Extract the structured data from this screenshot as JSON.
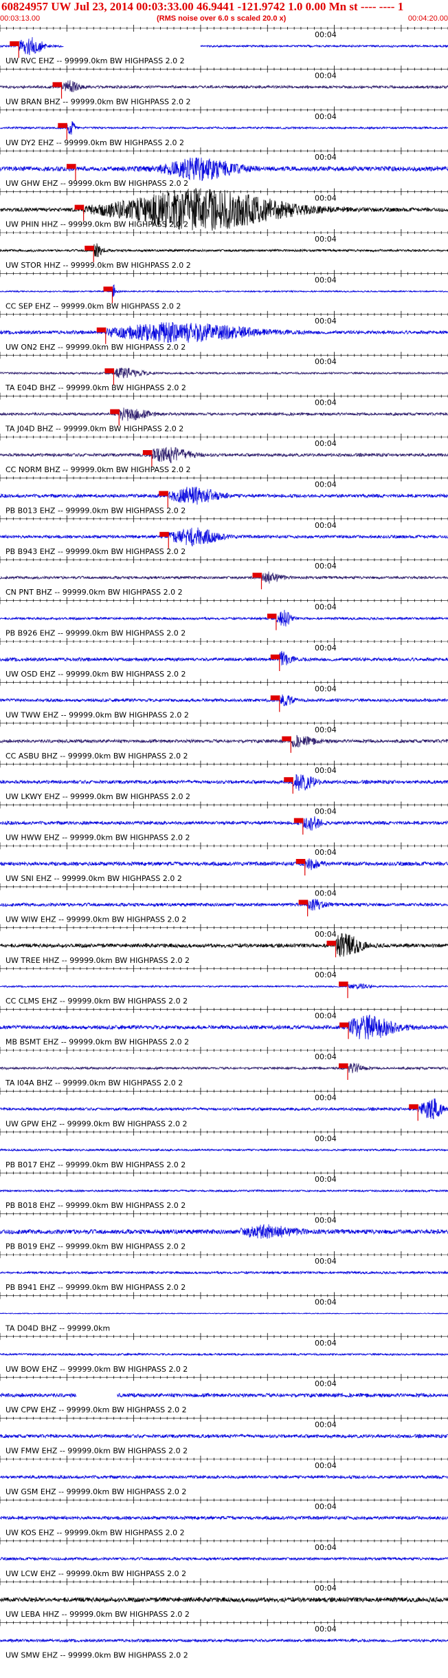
{
  "header": {
    "title": "60824957 UW Jul 23, 2014 00:03:33.00    46.9441 -121.9742  1.0 0.00 Mn st ---- ---- 1",
    "start_time": "00:03:13.00",
    "rms_note": "(RMS noise over 6.0 s scaled 20.0 x)",
    "end_time": "00:04:20.00",
    "tick_label": "00:04"
  },
  "colors": {
    "header_text": "#e00000",
    "pick": "#e00000",
    "trace_blue": "#0000dd",
    "trace_black": "#000000",
    "trace_purple": "#2a1a6a"
  },
  "chart_data": {
    "type": "line",
    "x_range_seconds": [
      0,
      67
    ],
    "x_tick_spacing_seconds": 1,
    "x_major_tick_spacing_seconds": 10,
    "channel_labels": [
      "UW RVC EHZ -- 99999.0km BW  HIGHPASS  2.0  2",
      "UW BRAN BHZ -- 99999.0km BW  HIGHPASS  2.0  2",
      "UW DY2 EHZ -- 99999.0km BW  HIGHPASS  2.0  2",
      "UW GHW EHZ -- 99999.0km BW  HIGHPASS  2.0  2",
      "UW PHIN HHZ -- 99999.0km BW  HIGHPASS  2.0  2",
      "UW STOR HHZ -- 99999.0km BW  HIGHPASS  2.0  2",
      "CC SEP EHZ -- 99999.0km BW  HIGHPASS  2.0  2",
      "UW ON2 EHZ -- 99999.0km BW  HIGHPASS  2.0  2",
      "TA E04D BHZ -- 99999.0km BW  HIGHPASS  2.0  2",
      "TA J04D BHZ -- 99999.0km BW  HIGHPASS  2.0  2",
      "CC NORM BHZ -- 99999.0km BW  HIGHPASS  2.0  2",
      "PB B013 EHZ -- 99999.0km BW  HIGHPASS  2.0  2",
      "PB B943 EHZ -- 99999.0km BW  HIGHPASS  2.0  2",
      "CN PNT BHZ -- 99999.0km BW  HIGHPASS  2.0  2",
      "PB B926 EHZ -- 99999.0km BW  HIGHPASS  2.0  2",
      "UW OSD EHZ -- 99999.0km BW  HIGHPASS  2.0  2",
      "UW TWW EHZ -- 99999.0km BW  HIGHPASS  2.0  2",
      "CC ASBU BHZ -- 99999.0km BW  HIGHPASS  2.0  2",
      "UW LKWY EHZ -- 99999.0km BW  HIGHPASS  2.0  2",
      "UW HWW EHZ -- 99999.0km BW  HIGHPASS  2.0  2",
      "UW SNI EHZ -- 99999.0km BW  HIGHPASS  2.0  2",
      "UW WIW EHZ -- 99999.0km BW  HIGHPASS  2.0  2",
      "UW TREE HHZ -- 99999.0km BW  HIGHPASS  2.0  2",
      "CC CLMS EHZ -- 99999.0km BW  HIGHPASS  2.0  2",
      "MB BSMT EHZ -- 99999.0km BW  HIGHPASS  2.0  2",
      "TA I04A BHZ -- 99999.0km BW  HIGHPASS  2.0  2",
      "UW GPW EHZ -- 99999.0km BW  HIGHPASS  2.0  2",
      "PB B017 EHZ -- 99999.0km BW  HIGHPASS  2.0  2",
      "PB B018 EHZ -- 99999.0km BW  HIGHPASS  2.0  2",
      "PB B019 EHZ -- 99999.0km BW  HIGHPASS  2.0  2",
      "PB B941 EHZ -- 99999.0km BW  HIGHPASS  2.0  2",
      "TA D04D BHZ -- 99999.0km",
      "UW BOW EHZ -- 99999.0km BW  HIGHPASS  2.0  2",
      "UW CPW EHZ -- 99999.0km BW  HIGHPASS  2.0  2",
      "UW FMW EHZ -- 99999.0km BW  HIGHPASS  2.0  2",
      "UW GSM EHZ -- 99999.0km BW  HIGHPASS  2.0  2",
      "UW KOS EHZ -- 99999.0km BW  HIGHPASS  2.0  2",
      "UW LCW EHZ -- 99999.0km BW  HIGHPASS  2.0  2",
      "UW LEBA HHZ -- 99999.0km BW  HIGHPASS  2.0  2",
      "UW SMW EHZ -- 99999.0km BW  HIGHPASS  2.0  2"
    ],
    "traces": [
      {
        "color": "blue",
        "noise": 0.12,
        "pick_s": 2.8,
        "burst_center_s": 4.5,
        "burst_amp": 1.1,
        "burst_width_s": 2.0,
        "gaps_s": [
          [
            9.5,
            30
          ]
        ]
      },
      {
        "color": "purple",
        "noise": 0.18,
        "pick_s": 9.2,
        "burst_center_s": 10.5,
        "burst_amp": 0.8,
        "burst_width_s": 1.2
      },
      {
        "color": "blue",
        "noise": 0.12,
        "pick_s": 10.0,
        "burst_center_s": 10.6,
        "burst_amp": 0.9,
        "burst_width_s": 0.6
      },
      {
        "color": "blue",
        "noise": 0.3,
        "pick_s": 11.3,
        "burst_center_s": 30.0,
        "burst_amp": 1.3,
        "burst_width_s": 5.0
      },
      {
        "color": "black",
        "noise": 0.25,
        "pick_s": 12.5,
        "burst_center_s": 30.0,
        "burst_amp": 2.6,
        "burst_width_s": 12.0
      },
      {
        "color": "black",
        "noise": 0.15,
        "pick_s": 14.0,
        "burst_center_s": 14.3,
        "burst_amp": 1.0,
        "burst_width_s": 1.0
      },
      {
        "color": "blue",
        "noise": 0.08,
        "pick_s": 16.8,
        "burst_center_s": 17.0,
        "burst_amp": 0.8,
        "burst_width_s": 0.5
      },
      {
        "color": "blue",
        "noise": 0.22,
        "pick_s": 15.8,
        "burst_center_s": 27.0,
        "burst_amp": 1.2,
        "burst_width_s": 10.0
      },
      {
        "color": "purple",
        "noise": 0.12,
        "pick_s": 17.0,
        "burst_center_s": 18.5,
        "burst_amp": 0.6,
        "burst_width_s": 3.0
      },
      {
        "color": "purple",
        "noise": 0.18,
        "pick_s": 17.8,
        "burst_center_s": 19.0,
        "burst_amp": 0.8,
        "burst_width_s": 3.0
      },
      {
        "color": "purple",
        "noise": 0.2,
        "pick_s": 22.7,
        "burst_center_s": 25.0,
        "burst_amp": 0.9,
        "burst_width_s": 3.5
      },
      {
        "color": "blue",
        "noise": 0.22,
        "pick_s": 25.1,
        "burst_center_s": 29.0,
        "burst_amp": 1.1,
        "burst_width_s": 3.5
      },
      {
        "color": "blue",
        "noise": 0.2,
        "pick_s": 25.2,
        "burst_center_s": 29.0,
        "burst_amp": 1.1,
        "burst_width_s": 3.5
      },
      {
        "color": "purple",
        "noise": 0.18,
        "pick_s": 39.1,
        "burst_center_s": 40.0,
        "burst_amp": 0.7,
        "burst_width_s": 2.0
      },
      {
        "color": "blue",
        "noise": 0.15,
        "pick_s": 41.3,
        "burst_center_s": 42.5,
        "burst_amp": 1.0,
        "burst_width_s": 1.0
      },
      {
        "color": "blue",
        "noise": 0.22,
        "pick_s": 41.8,
        "burst_center_s": 42.0,
        "burst_amp": 0.9,
        "burst_width_s": 1.5
      },
      {
        "color": "blue",
        "noise": 0.2,
        "pick_s": 41.8,
        "burst_center_s": 42.5,
        "burst_amp": 0.6,
        "burst_width_s": 1.5
      },
      {
        "color": "purple",
        "noise": 0.22,
        "pick_s": 43.5,
        "burst_center_s": 44.0,
        "burst_amp": 0.6,
        "burst_width_s": 3.0
      },
      {
        "color": "blue",
        "noise": 0.22,
        "pick_s": 43.8,
        "burst_center_s": 45.0,
        "burst_amp": 1.0,
        "burst_width_s": 2.0
      },
      {
        "color": "blue",
        "noise": 0.22,
        "pick_s": 45.3,
        "burst_center_s": 46.5,
        "burst_amp": 0.8,
        "burst_width_s": 1.5
      },
      {
        "color": "blue",
        "noise": 0.25,
        "pick_s": 45.6,
        "burst_center_s": 46.5,
        "burst_amp": 0.6,
        "burst_width_s": 1.5
      },
      {
        "color": "blue",
        "noise": 0.22,
        "pick_s": 46.0,
        "burst_center_s": 47.0,
        "burst_amp": 0.6,
        "burst_width_s": 1.5
      },
      {
        "color": "black",
        "noise": 0.25,
        "pick_s": 50.2,
        "burst_center_s": 51.5,
        "burst_amp": 1.4,
        "burst_width_s": 2.5
      },
      {
        "color": "blue",
        "noise": 0.1,
        "pick_s": 52.0,
        "burst_center_s": 53.5,
        "burst_amp": 0.3,
        "burst_width_s": 2.0
      },
      {
        "color": "blue",
        "noise": 0.25,
        "pick_s": 52.1,
        "burst_center_s": 55.0,
        "burst_amp": 1.5,
        "burst_width_s": 4.0
      },
      {
        "color": "purple",
        "noise": 0.15,
        "pick_s": 52.0,
        "burst_center_s": 53.0,
        "burst_amp": 0.6,
        "burst_width_s": 1.5
      },
      {
        "color": "blue",
        "noise": 0.18,
        "pick_s": 62.5,
        "burst_center_s": 64.5,
        "burst_amp": 1.4,
        "burst_width_s": 1.5
      },
      {
        "color": "blue",
        "noise": 0.12
      },
      {
        "color": "blue",
        "noise": 0.12
      },
      {
        "color": "blue",
        "noise": 0.3,
        "burst_center_s": 40.0,
        "burst_amp": 0.7,
        "burst_width_s": 4.0
      },
      {
        "color": "blue",
        "noise": 0.15
      },
      {
        "color": "blue",
        "noise": 0.05
      },
      {
        "color": "blue",
        "noise": 0.12
      },
      {
        "color": "blue",
        "noise": 0.25,
        "gaps_s": [
          [
            11.5,
            17.5
          ]
        ]
      },
      {
        "color": "blue",
        "noise": 0.22
      },
      {
        "color": "blue",
        "noise": 0.2
      },
      {
        "color": "blue",
        "noise": 0.22
      },
      {
        "color": "blue",
        "noise": 0.18
      },
      {
        "color": "black",
        "noise": 0.3
      },
      {
        "color": "blue",
        "noise": 0.18
      }
    ]
  }
}
